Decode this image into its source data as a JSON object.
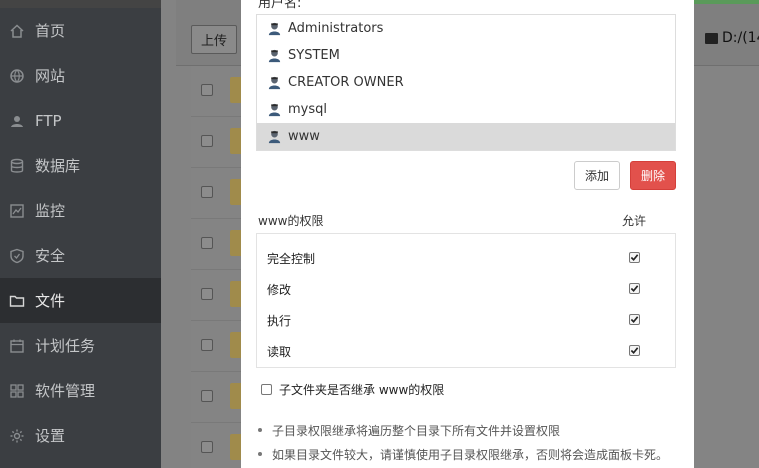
{
  "sidebar": {
    "items": [
      {
        "label": "首页",
        "icon": "home-icon"
      },
      {
        "label": "网站",
        "icon": "globe-icon"
      },
      {
        "label": "FTP",
        "icon": "ftp-user-icon"
      },
      {
        "label": "数据库",
        "icon": "database-icon"
      },
      {
        "label": "监控",
        "icon": "monitor-icon"
      },
      {
        "label": "安全",
        "icon": "shield-icon"
      },
      {
        "label": "文件",
        "icon": "folder-icon",
        "active": true
      },
      {
        "label": "计划任务",
        "icon": "calendar-icon"
      },
      {
        "label": "软件管理",
        "icon": "grid-icon"
      },
      {
        "label": "设置",
        "icon": "gear-icon"
      }
    ]
  },
  "background": {
    "upload_label": "上传",
    "disk_label": "D:/(14"
  },
  "modal": {
    "username_label": "用户名:",
    "users": [
      {
        "name": "Administrators",
        "selected": false
      },
      {
        "name": "SYSTEM",
        "selected": false
      },
      {
        "name": "CREATOR OWNER",
        "selected": false
      },
      {
        "name": "mysql",
        "selected": false
      },
      {
        "name": "www",
        "selected": true
      }
    ],
    "add_label": "添加",
    "delete_label": "删除",
    "perm_title": "www的权限",
    "allow_title": "允许",
    "permissions": [
      {
        "label": "完全控制",
        "allowed": true
      },
      {
        "label": "修改",
        "allowed": true
      },
      {
        "label": "执行",
        "allowed": true
      },
      {
        "label": "读取",
        "allowed": true
      }
    ],
    "inherit_label": "子文件夹是否继承 www的权限",
    "inherit_checked": false,
    "notes": [
      "子目录权限继承将遍历整个目录下所有文件并设置权限",
      "如果目录文件较大，请谨慎使用子目录权限继承，否则将会造成面板卡死。"
    ]
  },
  "colors": {
    "sidebar_bg": "#3b3e42",
    "delete_btn": "#e2514c",
    "selected_row": "#dadada"
  }
}
